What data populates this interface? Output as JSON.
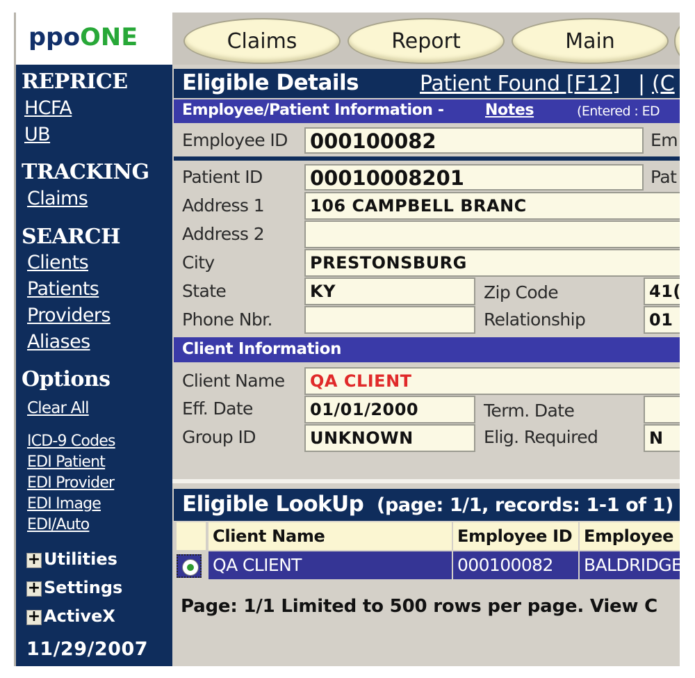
{
  "logo": {
    "part1": "ppo",
    "part2": "ONE"
  },
  "sidebar": {
    "reprice": {
      "title": "REPRICE",
      "links": [
        "HCFA",
        "UB"
      ]
    },
    "tracking": {
      "title": "TRACKING",
      "links": [
        "Claims"
      ]
    },
    "search": {
      "title": "SEARCH",
      "links": [
        "Clients",
        "Patients",
        "Providers",
        "Aliases"
      ]
    },
    "options": {
      "title": "Options",
      "clear_all": "Clear All",
      "links": [
        "ICD-9 Codes",
        "EDI Patient",
        "EDI Provider",
        "EDI Image",
        "EDI/Auto"
      ]
    },
    "expanders": [
      "Utilities",
      "Settings",
      "ActiveX"
    ],
    "date": "11/29/2007"
  },
  "tabs": [
    "Claims",
    "Report",
    "Main"
  ],
  "eligible": {
    "title": "Eligible Details",
    "patient_found": "Patient Found [F12]",
    "sep": "|",
    "next": "(C",
    "section1": "Employee/Patient Information - ",
    "notes": "Notes",
    "entered": "(Entered : ED",
    "employee_id_label": "Employee ID",
    "employee_id": "000100082",
    "em_cut": "Em",
    "patient_id_label": "Patient ID",
    "patient_id": "00010008201",
    "pat_cut": "Pat",
    "address1_label": "Address 1",
    "address1": "106 CAMPBELL BRANC",
    "address2_label": "Address 2",
    "address2": "",
    "city_label": "City",
    "city": "PRESTONSBURG",
    "state_label": "State",
    "state": "KY",
    "zip_label": "Zip Code",
    "zip": "41(",
    "phone_label": "Phone Nbr.",
    "phone": "",
    "relationship_label": "Relationship",
    "relationship": "01",
    "client_section": "Client Information",
    "client_name_label": "Client Name",
    "client_name": "QA CLIENT",
    "eff_label": "Eff. Date",
    "eff": "01/01/2000",
    "term_label": "Term. Date",
    "term": "",
    "group_label": "Group ID",
    "group": "UNKNOWN",
    "elig_label": "Elig. Required",
    "elig": "N"
  },
  "lookup": {
    "title": "Eligible LookUp",
    "paging": "(page: 1/1,  records: 1-1 of 1)",
    "columns": [
      "Client Name",
      "Employee ID",
      "Employee N"
    ],
    "row": [
      "QA CLIENT",
      "000100082",
      "BALDRIDGE"
    ],
    "footer": "Page: 1/1  Limited to 500 rows per page.  View C"
  }
}
